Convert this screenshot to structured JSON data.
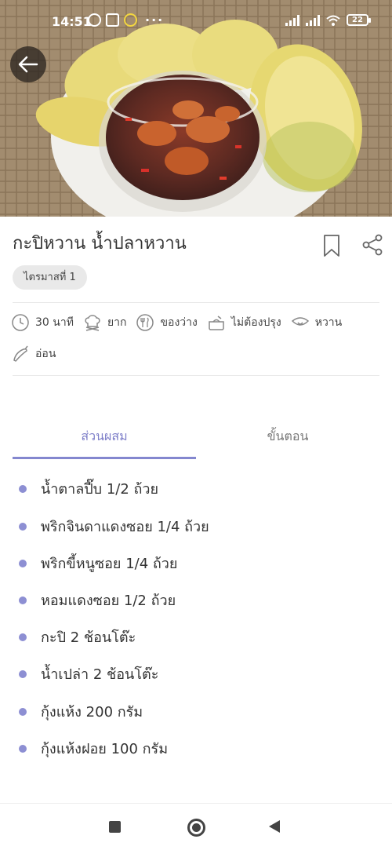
{
  "status_bar": {
    "time": "14:51",
    "more_indicator": "···",
    "battery": "22"
  },
  "recipe": {
    "title": "กะปิหวาน น้ำปลาหวาน",
    "tag": "ไตรมาสที่ 1",
    "info": [
      {
        "icon": "clock-icon",
        "label": "30 นาที"
      },
      {
        "icon": "chef-hat-icon",
        "label": "ยาก"
      },
      {
        "icon": "cutlery-icon",
        "label": "ของว่าง"
      },
      {
        "icon": "pot-icon",
        "label": "ไม่ต้องปรุง"
      },
      {
        "icon": "taste-icon",
        "label": "หวาน"
      },
      {
        "icon": "chili-icon",
        "label": "อ่อน"
      }
    ]
  },
  "tabs": {
    "ingredients": "ส่วนผสม",
    "steps": "ขั้นตอน"
  },
  "ingredients": [
    "น้ำตาลปี๊บ 1/2 ถ้วย",
    "พริกจินดาแดงซอย 1/4 ถ้วย",
    "พริกขี้หนูซอย 1/4 ถ้วย",
    "หอมแดงซอย 1/2 ถ้วย",
    "กะปิ 2 ช้อนโต๊ะ",
    "น้ำเปล่า 2 ช้อนโต๊ะ",
    "กุ้งแห้ง 200 กรัม",
    "กุ้งแห้งฝอย 100 กรัม"
  ],
  "colors": {
    "accent": "#8487cf",
    "bullet": "#8d8fd3",
    "chip_bg": "#e9e9e9"
  }
}
